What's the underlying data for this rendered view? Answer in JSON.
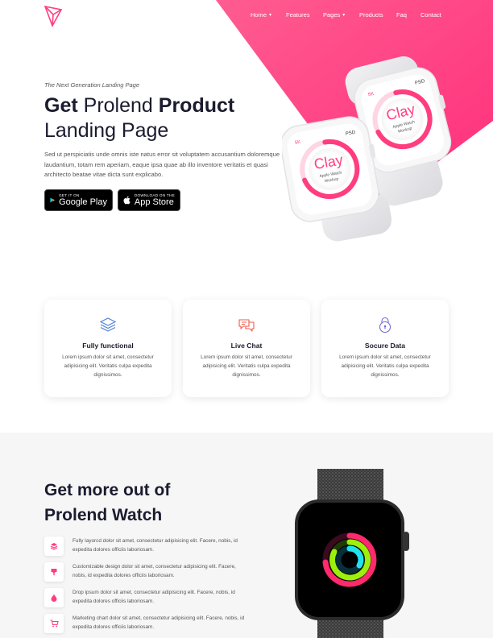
{
  "nav": {
    "items": [
      {
        "label": "Home",
        "dropdown": true
      },
      {
        "label": "Features",
        "dropdown": false
      },
      {
        "label": "Pages",
        "dropdown": true
      },
      {
        "label": "Products",
        "dropdown": false
      },
      {
        "label": "Faq",
        "dropdown": false
      },
      {
        "label": "Contact",
        "dropdown": false
      }
    ]
  },
  "hero": {
    "eyebrow": "The Next Generation Landing Page",
    "headline_line1_bold1": "Get",
    "headline_line1_light": "Prolend",
    "headline_line1_bold2": "Product",
    "headline_line2": "Landing Page",
    "description": "Sed ut perspiciatis unde omnis iste natus error sit voluptatem accusantium doloremque laudantium, totam rem aperiam, eaque ipsa quae ab illo inventore veritatis et quasi architecto beatae vitae dicta sunt explicabo.",
    "google_play": {
      "sub": "GET IT ON",
      "name": "Google Play"
    },
    "app_store": {
      "sub": "DOWNLOAD ON THE",
      "name": "App Store"
    },
    "watch_label_big": "Clay",
    "watch_label_small1": "Apple Watch",
    "watch_label_small2": "Mockup",
    "watch_corner_left": "5K",
    "watch_corner_right": "PSD"
  },
  "features": [
    {
      "title": "Fully functional",
      "text": "Lorem ipsum dolor sit amet, consectetur adipisicing elit. Veritatis culpa expedita dignissimos.",
      "icon": "layers-icon"
    },
    {
      "title": "Live Chat",
      "text": "Lorem ipsum dolor sit amet, consectetur adipisicing elit. Veritatis culpa expedita dignissimos.",
      "icon": "chat-icon"
    },
    {
      "title": "Socure Data",
      "text": "Lorem ipsum dolor sit amet, consectetur adipisicing elit. Veritatis culpa expedita dignissimos.",
      "icon": "lock-icon"
    }
  ],
  "section2": {
    "title_line1": "Get more out of",
    "title_line2": "Prolend Watch",
    "items": [
      {
        "text": "Fully layorcd dolor sit amet, consectetur adipisicing elit. Facere, nobis, id expedita dolores officiis laboriosam.",
        "icon": "stack-icon"
      },
      {
        "text": "Customizable design dolor sit amet, consectetur adipisicing elit. Facere, nobis, id expedita dolores officiis laboriosam.",
        "icon": "brush-icon"
      },
      {
        "text": "Drop ipsum dolor sit amet, consectetur adipisicing elit. Facere, nobis, id expedita dolores officiis laboriosam.",
        "icon": "drop-icon"
      },
      {
        "text": "Marketing chart dolor sit amet, consectetur adipisicing elit. Facere, nobis, id expedita dolores officiis laboriosam.",
        "icon": "cart-icon"
      }
    ]
  },
  "colors": {
    "brand_pink": "#ff3d7f",
    "brand_pink_light": "#ff6a9a",
    "icon_blue": "#4a7fd6",
    "icon_red": "#f05a4a",
    "icon_purple": "#6f6fd8"
  }
}
